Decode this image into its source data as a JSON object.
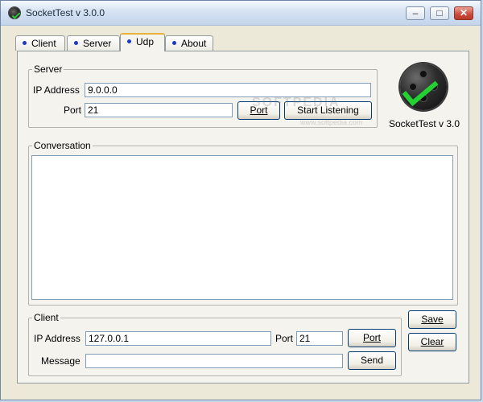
{
  "window": {
    "title": "SocketTest v 3.0.0",
    "minimize_symbol": "–",
    "maximize_symbol": "□",
    "close_symbol": "✕"
  },
  "tabs": [
    {
      "label": "Client",
      "active": false
    },
    {
      "label": "Server",
      "active": false
    },
    {
      "label": "Udp",
      "active": true
    },
    {
      "label": "About",
      "active": false
    }
  ],
  "server": {
    "legend": "Server",
    "ip_label": "IP Address",
    "ip_value": "9.0.0.0",
    "port_label": "Port",
    "port_value": "21",
    "port_button": "Port",
    "start_button": "Start Listening"
  },
  "logo": {
    "caption": "SocketTest v 3.0",
    "icon": "sockettest-logo-icon"
  },
  "watermark": {
    "text": "SOFTPEDIA",
    "subtext": "www.softpedia.com"
  },
  "conversation": {
    "legend": "Conversation",
    "content": ""
  },
  "client": {
    "legend": "Client",
    "ip_label": "IP Address",
    "ip_value": "127.0.0.1",
    "port_label": "Port",
    "port_value": "21",
    "port_button": "Port",
    "message_label": "Message",
    "message_value": "",
    "send_button": "Send"
  },
  "actions": {
    "save_button": "Save",
    "clear_button": "Clear"
  },
  "colors": {
    "tab_dot": "#1a3ac6",
    "active_tab_accent": "#e6b23c",
    "logo_check": "#23d133",
    "close_button": "#c9493a"
  }
}
